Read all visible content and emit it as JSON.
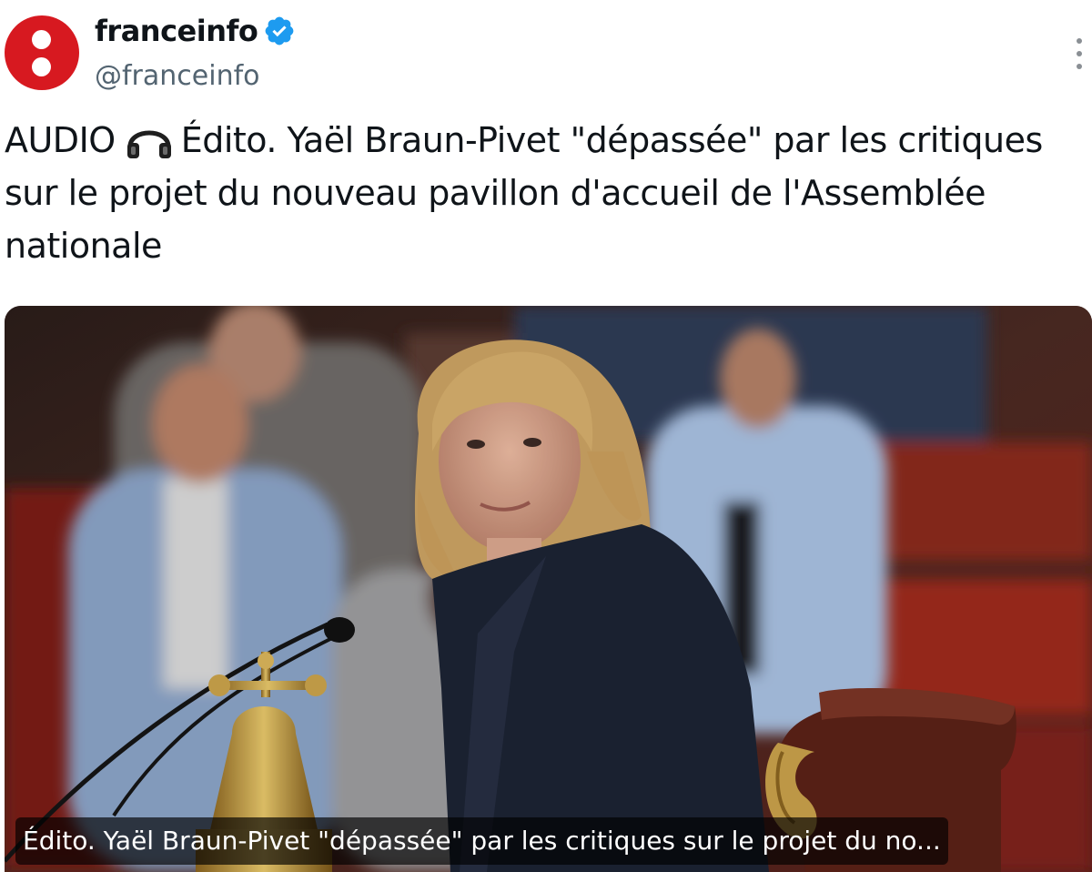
{
  "account": {
    "display_name": "franceinfo",
    "handle": "@franceinfo",
    "verified_icon": "verified-badge-icon",
    "avatar_color": "#d71920"
  },
  "tweet": {
    "prefix": "AUDIO",
    "prefix_icon": "headphones-icon",
    "text": "Édito. Yaël Braun-Pivet \"dépassée\" par les critiques sur le projet du nouveau pavillon d'accueil de l'Assemblée nationale"
  },
  "media": {
    "caption": "Édito. Yaël Braun-Pivet \"dépassée\" par les critiques sur le projet du no..."
  },
  "colors": {
    "text": "#0f1419",
    "secondary": "#536471",
    "verified": "#1d9bf0"
  }
}
